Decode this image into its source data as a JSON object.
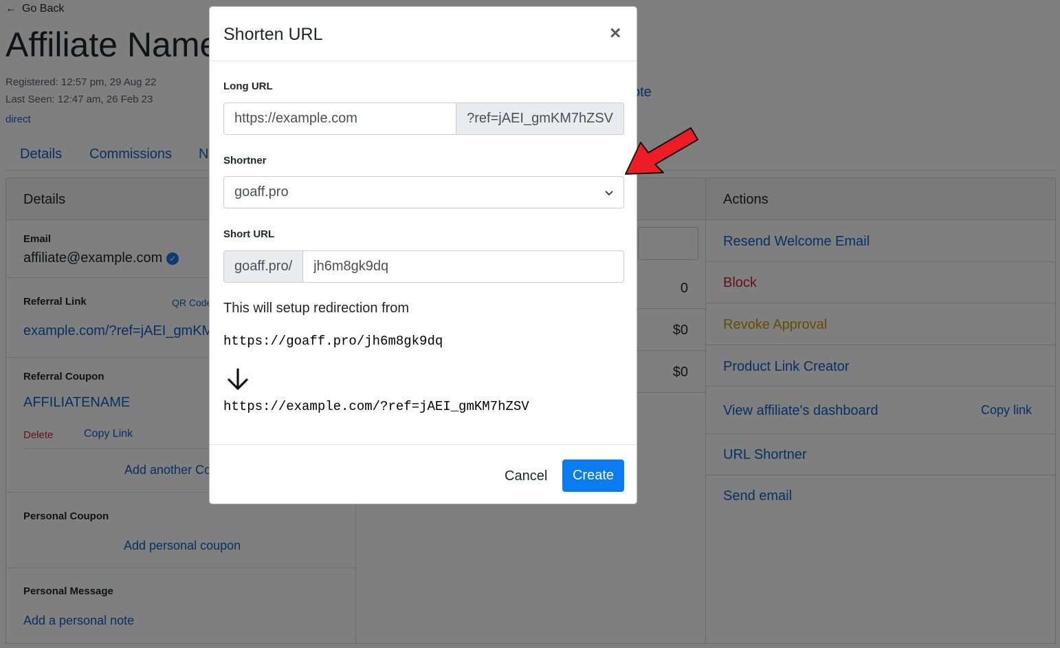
{
  "colors": {
    "accent": "#0a7cf0",
    "link": "#0b62c9",
    "danger": "#c82333",
    "warning": "#c89b00",
    "annotation_arrow": "#ee1c24"
  },
  "background": {
    "go_back": "Go Back",
    "affiliate_name": "Affiliate Name",
    "registered": "Registered: 12:57 pm, 29 Aug 22",
    "last_seen": "Last Seen: 12:47 am, 26 Feb 23",
    "source": "direct",
    "note_link_fragment": "ote",
    "tabs": [
      "Details",
      "Commissions",
      "N"
    ],
    "details_panel": {
      "title": "Details",
      "email_label": "Email",
      "email_value": "affiliate@example.com",
      "referral_link_label": "Referral Link",
      "qr_code": "QR Code",
      "referral_link_value": "example.com/?ref=jAEI_gmKM",
      "referral_coupon_label": "Referral Coupon",
      "coupon_code": "AFFILIATENAME",
      "delete": "Delete",
      "copy_link": "Copy Link",
      "add_another_coupon": "Add another Co",
      "personal_coupon_label": "Personal Coupon",
      "add_personal_coupon": "Add personal coupon",
      "personal_message_label": "Personal Message",
      "add_personal_note": "Add a personal note"
    },
    "middle_panel": {
      "values": [
        "0",
        "$0",
        "$0"
      ]
    },
    "actions_panel": {
      "title": "Actions",
      "items": [
        "Resend Welcome Email",
        "Block",
        "Revoke Approval",
        "Product Link Creator",
        "View affiliate's dashboard",
        "URL Shortner",
        "Send email"
      ],
      "copy_link": "Copy link"
    }
  },
  "modal": {
    "title": "Shorten URL",
    "close": "×",
    "long_url_label": "Long URL",
    "long_url_value": "https://example.com",
    "long_url_suffix": "?ref=jAEI_gmKM7hZSV",
    "shortner_label": "Shortner",
    "shortner_selected": "goaff.pro",
    "short_url_label": "Short URL",
    "short_url_prefix": "goaff.pro/",
    "short_url_value": "jh6m8gk9dq",
    "redirect_text": "This will setup redirection from",
    "redirect_from": "https://goaff.pro/jh6m8gk9dq",
    "redirect_to": "https://example.com/?ref=jAEI_gmKM7hZSV",
    "cancel_label": "Cancel",
    "create_label": "Create"
  }
}
